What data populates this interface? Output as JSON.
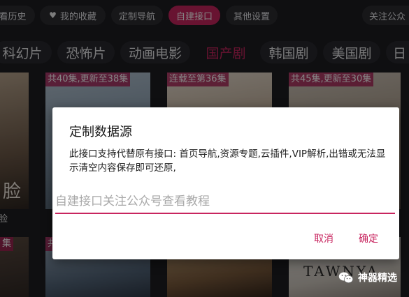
{
  "top_nav": {
    "items": [
      {
        "label": "看历史"
      },
      {
        "label": "我的收藏",
        "icon": "heart-icon"
      },
      {
        "label": "定制导航"
      },
      {
        "label": "自建接口",
        "active": true
      },
      {
        "label": "其他设置"
      },
      {
        "label": "关注公众"
      }
    ]
  },
  "categories": [
    {
      "label": "科幻片"
    },
    {
      "label": "恐怖片"
    },
    {
      "label": "动画电影"
    },
    {
      "label": "国产剧",
      "active": true
    },
    {
      "label": "韩国剧"
    },
    {
      "label": "美国剧"
    },
    {
      "label": "日"
    }
  ],
  "posters": [
    {
      "badge": "",
      "title": "脸"
    },
    {
      "badge": "共40集,更新至38集"
    },
    {
      "badge": "连载至第36集"
    },
    {
      "badge": "共45集,更新至30集"
    },
    {
      "badge": "集"
    },
    {
      "badge": "共"
    },
    {
      "badge": ""
    },
    {
      "badge": "",
      "art_text": "TAWNYA"
    }
  ],
  "dialog": {
    "title": "定制数据源",
    "message": "此接口支持代替原有接口: 首页导航,资源专题,云插件,VIP解析,出错或无法显示清空内容保存即可还原,",
    "input_value": "",
    "input_placeholder": "自建接口关注公众号查看教程",
    "cancel_label": "取消",
    "confirm_label": "确定"
  },
  "watermark": {
    "text": "神器精选",
    "icon": "wechat-icon"
  },
  "colors": {
    "accent": "#c8255f",
    "background": "#1d1d21"
  }
}
